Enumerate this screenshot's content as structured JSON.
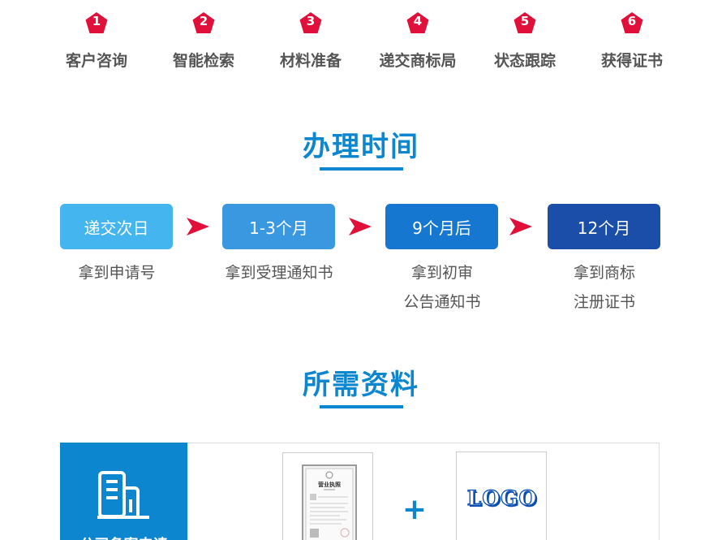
{
  "steps": [
    {
      "num": "1",
      "label": "客户咨询"
    },
    {
      "num": "2",
      "label": "智能检索"
    },
    {
      "num": "3",
      "label": "材料准备"
    },
    {
      "num": "4",
      "label": "递交商标局"
    },
    {
      "num": "5",
      "label": "状态跟踪"
    },
    {
      "num": "6",
      "label": "获得证书"
    }
  ],
  "time_section": {
    "title": "办理时间",
    "stages": [
      {
        "box": "递交次日",
        "line1": "拿到申请号",
        "line2": "",
        "color": "#45b5f0"
      },
      {
        "box": "1-3个月",
        "line1": "拿到受理通知书",
        "line2": "",
        "color": "#3a98e0"
      },
      {
        "box": "9个月后",
        "line1": "拿到初审",
        "line2": "公告通知书",
        "color": "#1677d0"
      },
      {
        "box": "12个月",
        "line1": "拿到商标",
        "line2": "注册证书",
        "color": "#1a4ea8"
      }
    ]
  },
  "materials_section": {
    "title": "所需资料",
    "side_label": "公司备案申请",
    "doc_title": "营业执照",
    "plus": "+",
    "logo_text": "LOGO"
  },
  "colors": {
    "accent": "#0b86cf",
    "step_badge": "#e0103a",
    "arrow": "#e0103a"
  },
  "icons": {
    "step_badge": "pentagon-badge-icon",
    "arrow": "arrow-right-icon",
    "building": "building-icon"
  }
}
